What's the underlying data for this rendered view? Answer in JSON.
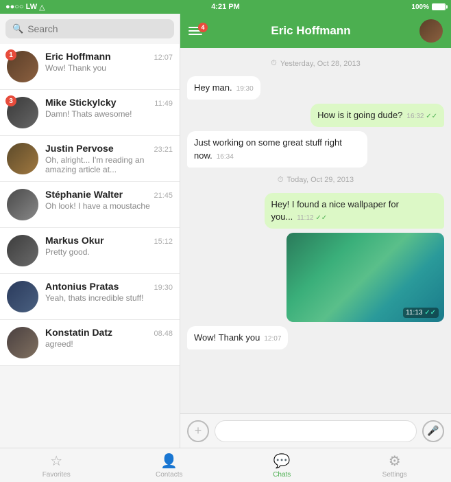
{
  "statusBar": {
    "signal": "●●○○ LW",
    "wifi": "wifi",
    "time": "4:21 PM",
    "battery": "100%"
  },
  "header": {
    "contactName": "Eric Hoffmann",
    "menuBadge": "4"
  },
  "search": {
    "placeholder": "Search"
  },
  "chats": [
    {
      "id": 1,
      "name": "Eric Hoffmann",
      "time": "12:07",
      "preview": "Wow! Thank you",
      "badge": "1",
      "avatarClass": "av1"
    },
    {
      "id": 2,
      "name": "Mike Stickylcky",
      "time": "11:49",
      "preview": "Damn! Thats awesome!",
      "badge": "3",
      "avatarClass": "av2"
    },
    {
      "id": 3,
      "name": "Justin Pervose",
      "time": "23:21",
      "preview": "Oh, alright... I'm reading an amazing article at...",
      "badge": null,
      "avatarClass": "av3"
    },
    {
      "id": 4,
      "name": "Stéphanie Walter",
      "time": "21:45",
      "preview": "Oh look! I have a moustache",
      "badge": null,
      "avatarClass": "av4"
    },
    {
      "id": 5,
      "name": "Markus Okur",
      "time": "15:12",
      "preview": "Pretty good.",
      "badge": null,
      "avatarClass": "av5"
    },
    {
      "id": 6,
      "name": "Antonius Pratas",
      "time": "19:30",
      "preview": "Yeah, thats incredible stuff!",
      "badge": null,
      "avatarClass": "av6"
    },
    {
      "id": 7,
      "name": "Konstatin Datz",
      "time": "08.48",
      "preview": "agreed!",
      "badge": null,
      "avatarClass": "av7"
    }
  ],
  "messages": [
    {
      "type": "date",
      "text": "Yesterday, Oct 28, 2013"
    },
    {
      "type": "received",
      "text": "Hey man.",
      "time": "19:30"
    },
    {
      "type": "sent",
      "text": "How is it going dude?",
      "time": "16:32",
      "ticks": "✓✓"
    },
    {
      "type": "received",
      "text": "Just working on some great stuff right now.",
      "time": "16:34"
    },
    {
      "type": "date",
      "text": "Today, Oct 29, 2013"
    },
    {
      "type": "sent",
      "text": "Hey! I found a nice wallpaper for you...",
      "time": "11:12",
      "ticks": "✓✓"
    },
    {
      "type": "sent-image",
      "time": "11:13",
      "ticks": "✓✓"
    },
    {
      "type": "received",
      "text": "Wow! Thank you",
      "time": "12:07"
    }
  ],
  "tabs": [
    {
      "icon": "☆",
      "label": "Favorites",
      "active": false
    },
    {
      "icon": "👤",
      "label": "Contacts",
      "active": false
    },
    {
      "icon": "💬",
      "label": "Chats",
      "active": true
    },
    {
      "icon": "⚙",
      "label": "Settings",
      "active": false
    }
  ],
  "inputPlaceholder": ""
}
